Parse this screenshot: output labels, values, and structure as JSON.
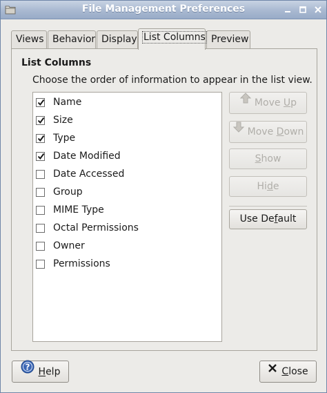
{
  "window": {
    "title": "File Management Preferences"
  },
  "tabs": [
    {
      "label": "Views"
    },
    {
      "label": "Behavior"
    },
    {
      "label": "Display"
    },
    {
      "label": "List Columns",
      "active": true
    },
    {
      "label": "Preview"
    }
  ],
  "list_columns": {
    "section_title": "List Columns",
    "description": "Choose the order of information to appear in the list view.",
    "items": [
      {
        "label": "Name",
        "checked": true
      },
      {
        "label": "Size",
        "checked": true
      },
      {
        "label": "Type",
        "checked": true
      },
      {
        "label": "Date Modified",
        "checked": true
      },
      {
        "label": "Date Accessed",
        "checked": false
      },
      {
        "label": "Group",
        "checked": false
      },
      {
        "label": "MIME Type",
        "checked": false
      },
      {
        "label": "Octal Permissions",
        "checked": false
      },
      {
        "label": "Owner",
        "checked": false
      },
      {
        "label": "Permissions",
        "checked": false
      }
    ]
  },
  "side_buttons": {
    "move_up": {
      "label_pre": "Move ",
      "label_key": "U",
      "label_post": "p",
      "icon": "arrow-up-icon",
      "enabled": false
    },
    "move_down": {
      "label_pre": "Move ",
      "label_key": "D",
      "label_post": "own",
      "icon": "arrow-down-icon",
      "enabled": false
    },
    "show": {
      "label_pre": "",
      "label_key": "S",
      "label_post": "how",
      "enabled": false
    },
    "hide": {
      "label_pre": "Hi",
      "label_key": "d",
      "label_post": "e",
      "enabled": false
    },
    "use_default": {
      "label_pre": "Use De",
      "label_key": "f",
      "label_post": "ault",
      "enabled": true
    }
  },
  "footer": {
    "help": {
      "label_pre": "",
      "label_key": "H",
      "label_post": "elp",
      "icon": "help-icon"
    },
    "close": {
      "label_pre": "",
      "label_key": "C",
      "label_post": "lose",
      "icon": "close-x-icon"
    }
  },
  "colors": {
    "titlebar": "#a9b9d1",
    "window_bg": "#ecebe8",
    "disabled_text": "#b0aea9"
  }
}
